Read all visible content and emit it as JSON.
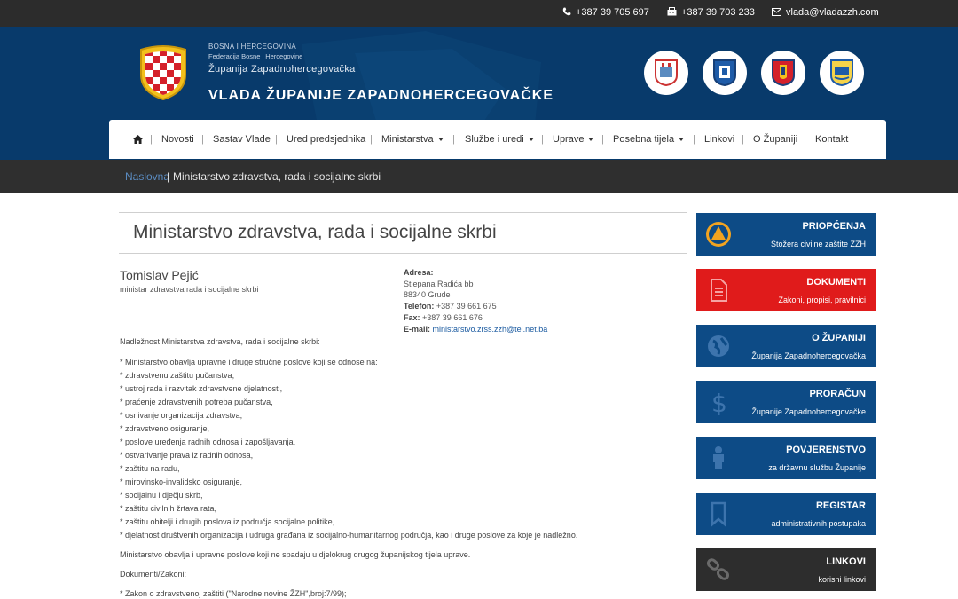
{
  "topbar": {
    "phone": "+387 39 705 697",
    "fax": "+387 39 703 233",
    "email": "vlada@vladazzh.com"
  },
  "header": {
    "line1": "BOSNA I HERCEGOVINA",
    "line2": "Federacija Bosne i Hercegovine",
    "line3": "Županija Zapadnohercegovačka",
    "title": "VLADA ŽUPANIJE ZAPADNOHERCEGOVAČKE",
    "municipality_icons": [
      "municipality-crest-1-icon",
      "municipality-crest-2-icon",
      "municipality-crest-3-icon",
      "municipality-crest-4-icon"
    ]
  },
  "nav": {
    "home_icon": "home-icon",
    "items": [
      "Novosti",
      "Sastav Vlade",
      "Ured predsjednika",
      "Ministarstva",
      "Službe i uredi",
      "Uprave",
      "Posebna tijela",
      "Linkovi",
      "O Županiji",
      "Kontakt"
    ]
  },
  "breadcrumb": {
    "home": "Naslovna",
    "separator": "|",
    "current": "Ministarstvo zdravstva, rada i socijalne skrbi"
  },
  "page": {
    "title": "Ministarstvo zdravstva, rada i socijalne skrbi",
    "minister_name": "Tomislav Pejić",
    "minister_role": "ministar zdravstva rada i socijalne skrbi"
  },
  "contact": {
    "address_label": "Adresa:",
    "street": "Stjepana Radića bb",
    "city": "88340 Grude",
    "phone_label": "Telefon:",
    "phone": "+387 39 661 675",
    "fax_label": "Fax:",
    "fax": "+387 39 661 676",
    "email_label": "E-mail:",
    "email": "ministarstvo.zrss.zzh@tel.net.ba"
  },
  "body": {
    "intro": "Nadležnost Ministarstva zdravstva, rada i socijalne skrbi:",
    "bullets": [
      "* Ministarstvo obavlja upravne i druge stručne poslove koji se odnose na:",
      "* zdravstvenu zaštitu pučanstva,",
      "* ustroj rada i razvitak zdravstvene djelatnosti,",
      "* praćenje zdravstvenih potreba pučanstva,",
      "* osnivanje organizacija zdravstva,",
      "* zdravstveno osiguranje,",
      "* poslove uređenja radnih odnosa i zapošljavanja,",
      "* ostvarivanje prava iz radnih odnosa,",
      "* zaštitu na radu,",
      "* mirovinsko-invalidsko osiguranje,",
      "* socijalnu i dječju skrb,",
      "* zaštitu civilnih žrtava rata,",
      "* zaštitu obitelji i drugih poslova iz područja socijalne politike,",
      "* djelatnost društvenih organizacija i udruga građana iz socijalno-humanitarnog područja, kao i druge poslove za koje je nadležno."
    ],
    "closing": "Ministarstvo obavlja i upravne poslove koji ne spadaju u djelokrug drugog županijskog tijela uprave.",
    "docs_heading": "Dokumenti/Zakoni:",
    "docs_first": "* Zakon o zdravstvenoj zaštiti (\"Narodne novine ŽZH\",broj:7/99);"
  },
  "sidebar": [
    {
      "title": "PRIOPĆENJA",
      "subtitle": "Stožera civilne zaštite ŽZH",
      "icon": "civil-protection-icon",
      "color": "#0d4b86"
    },
    {
      "title": "DOKUMENTI",
      "subtitle": "Zakoni, propisi, pravilnici",
      "icon": "document-icon",
      "color": "#e01b1b"
    },
    {
      "title": "O ŽUPANIJI",
      "subtitle": "Županija Zapadnohercegovačka",
      "icon": "globe-icon",
      "color": "#0d4b86"
    },
    {
      "title": "PRORAČUN",
      "subtitle": "Županije Zapadnohercegovačke",
      "icon": "dollar-icon",
      "color": "#0d4b86"
    },
    {
      "title": "POVJERENSTVO",
      "subtitle": "za državnu službu Županije",
      "icon": "person-icon",
      "color": "#0d4b86"
    },
    {
      "title": "REGISTAR",
      "subtitle": "administrativnih postupaka",
      "icon": "bookmark-icon",
      "color": "#0d4b86"
    },
    {
      "title": "LINKOVI",
      "subtitle": "korisni linkovi",
      "icon": "link-icon",
      "color": "#2d2d2d"
    }
  ]
}
